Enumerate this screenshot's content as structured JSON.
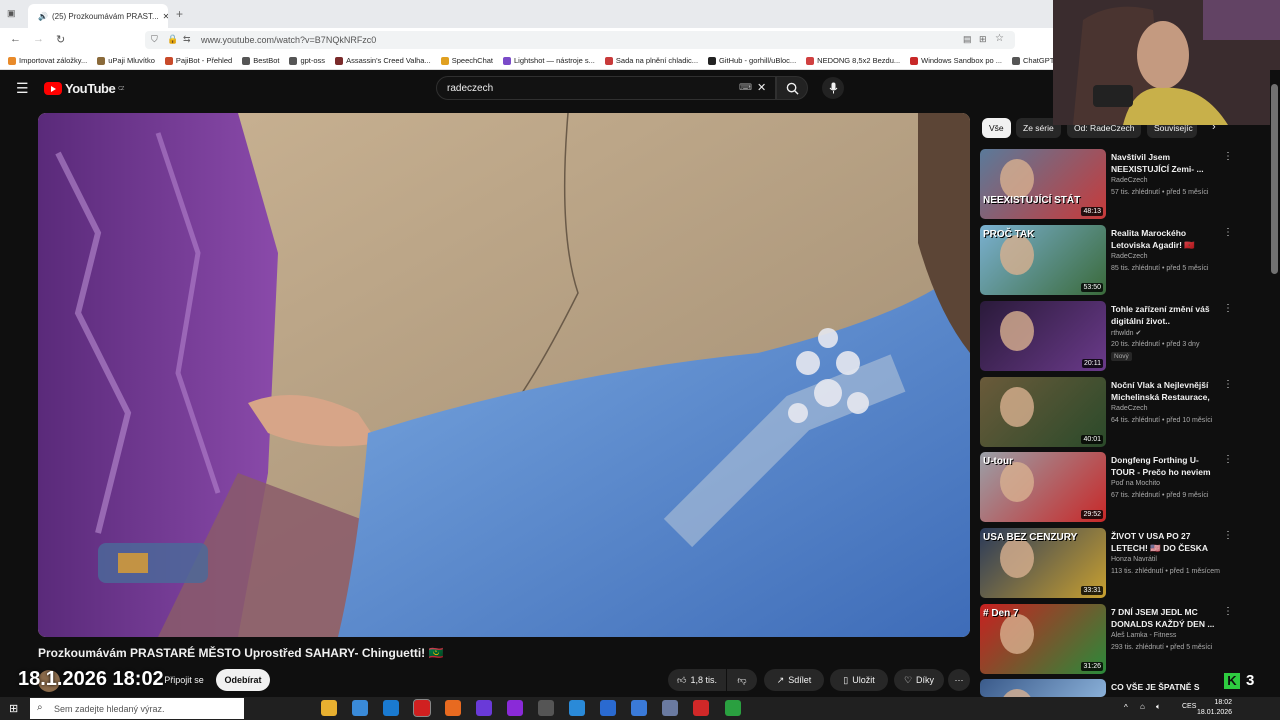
{
  "browser": {
    "tab_title": "(25) Prozkoumávám PRAST...",
    "url": "www.youtube.com/watch?v=B7NQkNRFzc0",
    "bookmarks": [
      "Importovat záložky...",
      "uPaji Mluvítko",
      "PajiBot - Přehled",
      "BestBot",
      "gpt-oss",
      "Assassin's Creed Valha...",
      "SpeechChat",
      "Lightshot — nástroje s...",
      "Sada na plnění chladic...",
      "GitHub - gorhill/uBloc...",
      "NEDONG 8,5x2 Bezdu...",
      "Windows Sandbox po ...",
      "ChatGPT - Česky"
    ]
  },
  "youtube": {
    "logo_text": "YouTube",
    "logo_region": "CZ",
    "search_value": "radeczech"
  },
  "video": {
    "title": "Prozkoumávám PRASTARÉ MĚSTO Uprostřed SAHARY- Chinguetti! 🇲🇷",
    "date_overlay": "18.1.2026 18:02",
    "join_label": "Připojit se",
    "subscribe_label": "Odebírat",
    "likes": "1,8 tis.",
    "share_label": "Sdílet",
    "save_label": "Uložit",
    "thanks_label": "Díky"
  },
  "chips": [
    "Vše",
    "Ze série",
    "Od: RadeCzech",
    "Souvisejíc"
  ],
  "recommendations": [
    {
      "title": "Navštívil Jsem NEEXISTUJÍCÍ Zemi- ...",
      "channel": "RadeCzech",
      "meta": "57 tis. zhlédnutí • před 5 měsíci",
      "duration": "48:13",
      "thumb_text": "NEEXISTUJÍCÍ STÁT",
      "badge": "",
      "c1": "#5a7a9a",
      "c2": "#c83a3a"
    },
    {
      "title": "Realita Marockého Letoviska Agadir! 🇲🇦",
      "channel": "RadeCzech",
      "meta": "85 tis. zhlédnutí • před 5 měsíci",
      "duration": "53:50",
      "thumb_text": "PROČ TAK",
      "badge": "",
      "c1": "#7ab0d0",
      "c2": "#3a6a3a"
    },
    {
      "title": "Tohle zařízení změní váš digitální život..",
      "channel": "rthwldn ✔",
      "meta": "20 tis. zhlédnutí • před 3 dny",
      "duration": "20:11",
      "thumb_text": "",
      "badge": "Nový",
      "c1": "#2a1a3a",
      "c2": "#6a3a8a"
    },
    {
      "title": "Noční Vlak a Nejlevnější Michelinská Restaurace, ...",
      "channel": "RadeCzech",
      "meta": "64 tis. zhlédnutí • před 10 měsíci",
      "duration": "40:01",
      "thumb_text": "",
      "badge": "",
      "c1": "#6a5a3a",
      "c2": "#2a4a2a"
    },
    {
      "title": "Dongfeng Forthing U-TOUR - Prečo ho neviem ...",
      "channel": "Poď na Mochito",
      "meta": "67 tis. zhlédnutí • před 9 měsíci",
      "duration": "29:52",
      "thumb_text": "U-tour",
      "badge": "",
      "c1": "#9aa0a8",
      "c2": "#c82828"
    },
    {
      "title": "ŽIVOT V USA PO 27 LETECH! 🇺🇸 DO ČESKA S...",
      "channel": "Honza Navrátil",
      "meta": "113 tis. zhlédnutí • před 1 měsícem",
      "duration": "33:31",
      "thumb_text": "USA BEZ CENZURY",
      "badge": "",
      "c1": "#2a3a5a",
      "c2": "#c8a030"
    },
    {
      "title": "7 DNÍ JSEM JEDL MC DONALDS KAŽDÝ DEN ...",
      "channel": "Aleš Lamka - Fitness",
      "meta": "293 tis. zhlédnutí • před 5 měsíci",
      "duration": "31:26",
      "thumb_text": "# Den 7",
      "badge": "",
      "c1": "#c82020",
      "c2": "#2a8a3a"
    },
    {
      "title": "CO VŠE JE ŠPATNĚ S",
      "channel": "",
      "meta": "",
      "duration": "",
      "thumb_text": "",
      "badge": "",
      "c1": "#3a5a8a",
      "c2": "#8ab0d8"
    }
  ],
  "taskbar": {
    "search_placeholder": "Sem zadejte hledaný výraz.",
    "time": "18:02",
    "date": "18.01.2026",
    "lang": "CES"
  },
  "overlay_counter": "3"
}
